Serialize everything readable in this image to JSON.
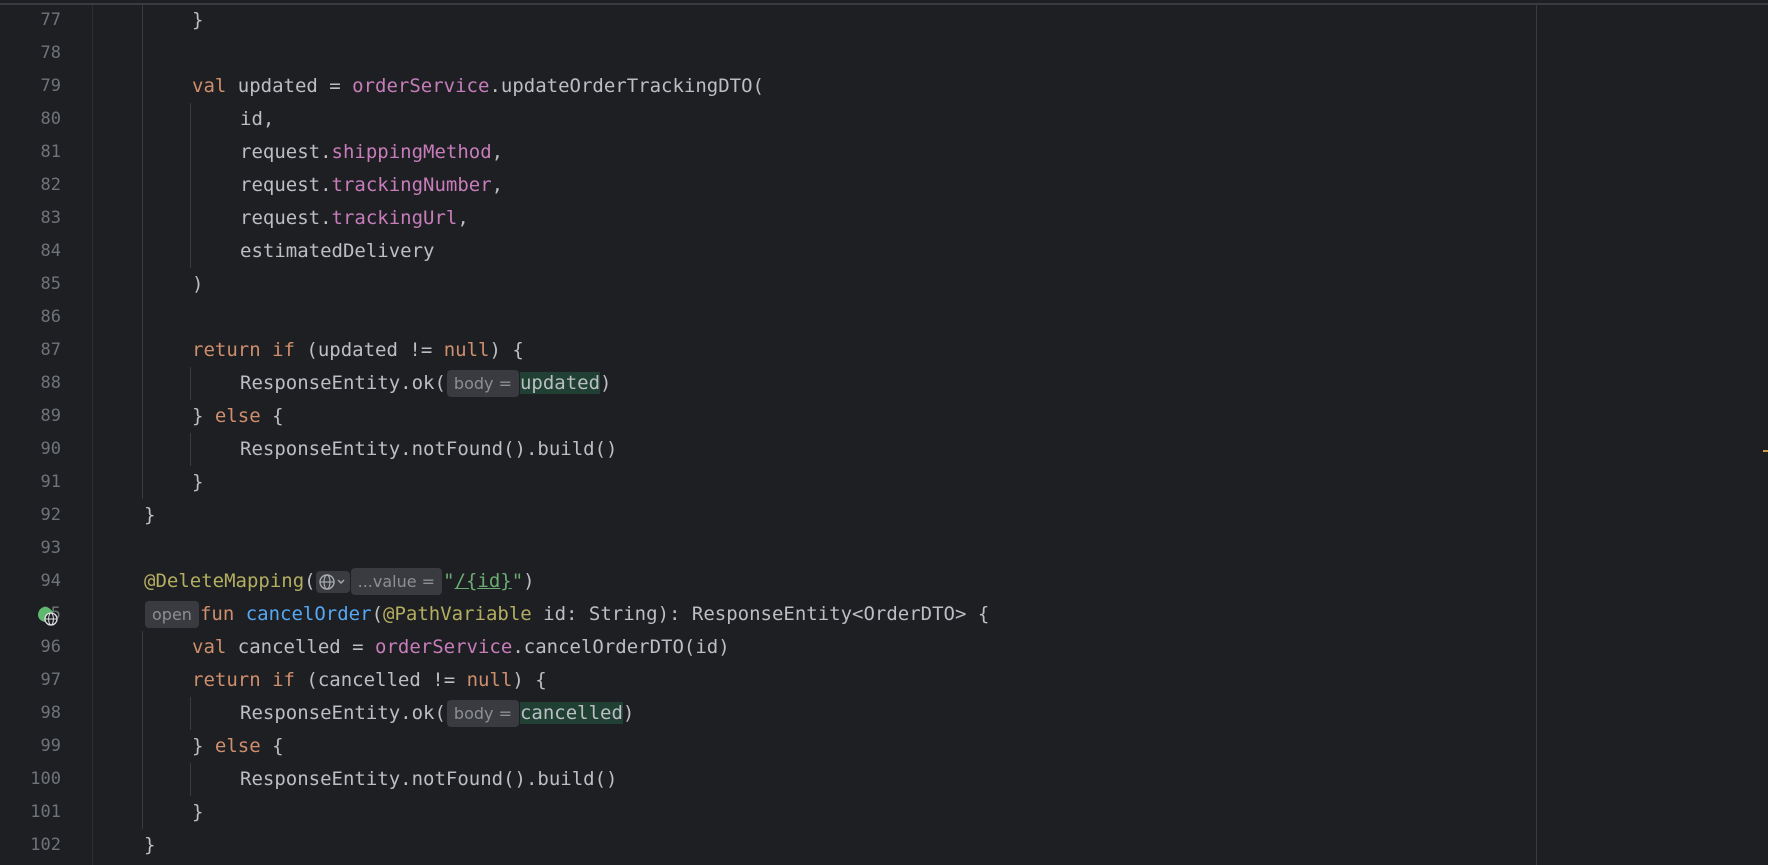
{
  "editor": {
    "lines": [
      {
        "num": "77",
        "indent": 2,
        "tokens": [
          {
            "t": "}",
            "c": "plain"
          }
        ]
      },
      {
        "num": "78",
        "indent": 0,
        "tokens": []
      },
      {
        "num": "79",
        "indent": 2,
        "tokens": [
          {
            "t": "val",
            "c": "kw"
          },
          {
            "t": " updated = ",
            "c": "plain"
          },
          {
            "t": "orderService",
            "c": "prop"
          },
          {
            "t": ".updateOrderTrackingDTO(",
            "c": "plain"
          }
        ]
      },
      {
        "num": "80",
        "indent": 3,
        "tokens": [
          {
            "t": "id,",
            "c": "plain"
          }
        ]
      },
      {
        "num": "81",
        "indent": 3,
        "tokens": [
          {
            "t": "request.",
            "c": "plain"
          },
          {
            "t": "shippingMethod",
            "c": "prop"
          },
          {
            "t": ",",
            "c": "plain"
          }
        ]
      },
      {
        "num": "82",
        "indent": 3,
        "tokens": [
          {
            "t": "request.",
            "c": "plain"
          },
          {
            "t": "trackingNumber",
            "c": "prop"
          },
          {
            "t": ",",
            "c": "plain"
          }
        ]
      },
      {
        "num": "83",
        "indent": 3,
        "tokens": [
          {
            "t": "request.",
            "c": "plain"
          },
          {
            "t": "trackingUrl",
            "c": "prop"
          },
          {
            "t": ",",
            "c": "plain"
          }
        ]
      },
      {
        "num": "84",
        "indent": 3,
        "tokens": [
          {
            "t": "estimatedDelivery",
            "c": "plain"
          }
        ]
      },
      {
        "num": "85",
        "indent": 2,
        "tokens": [
          {
            "t": ")",
            "c": "plain"
          }
        ]
      },
      {
        "num": "86",
        "indent": 0,
        "tokens": []
      },
      {
        "num": "87",
        "indent": 2,
        "tokens": [
          {
            "t": "return",
            "c": "kw"
          },
          {
            "t": " ",
            "c": "plain"
          },
          {
            "t": "if",
            "c": "kw"
          },
          {
            "t": " (updated != ",
            "c": "plain"
          },
          {
            "t": "null",
            "c": "kw"
          },
          {
            "t": ") {",
            "c": "plain"
          }
        ]
      },
      {
        "num": "88",
        "indent": 3,
        "tokens": [
          {
            "t": "ResponseEntity.ok(",
            "c": "plain"
          },
          {
            "t": "body =",
            "c": "hint"
          },
          {
            "t": "updated",
            "c": "hl"
          },
          {
            "t": ")",
            "c": "plain"
          }
        ]
      },
      {
        "num": "89",
        "indent": 2,
        "tokens": [
          {
            "t": "} ",
            "c": "plain"
          },
          {
            "t": "else",
            "c": "kw"
          },
          {
            "t": " {",
            "c": "plain"
          }
        ]
      },
      {
        "num": "90",
        "indent": 3,
        "tokens": [
          {
            "t": "ResponseEntity.notFound().build()",
            "c": "plain"
          }
        ]
      },
      {
        "num": "91",
        "indent": 2,
        "tokens": [
          {
            "t": "}",
            "c": "plain"
          }
        ]
      },
      {
        "num": "92",
        "indent": 1,
        "tokens": [
          {
            "t": "}",
            "c": "plain"
          }
        ]
      },
      {
        "num": "93",
        "indent": 0,
        "tokens": []
      },
      {
        "num": "94",
        "indent": 1,
        "tokens": [
          {
            "t": "@DeleteMapping",
            "c": "ann"
          },
          {
            "t": "(",
            "c": "plain"
          },
          {
            "t": "globe",
            "c": "globe"
          },
          {
            "t": "...value =",
            "c": "hint"
          },
          {
            "t": "\"",
            "c": "str"
          },
          {
            "t": "/{id}",
            "c": "strlink"
          },
          {
            "t": "\"",
            "c": "str"
          },
          {
            "t": ")",
            "c": "plain"
          }
        ]
      },
      {
        "num": "95",
        "indent": 1,
        "tokens": [
          {
            "t": "open",
            "c": "hint"
          },
          {
            "t": "fun",
            "c": "kw"
          },
          {
            "t": " ",
            "c": "plain"
          },
          {
            "t": "cancelOrder",
            "c": "fn"
          },
          {
            "t": "(",
            "c": "plain"
          },
          {
            "t": "@PathVariable",
            "c": "ann"
          },
          {
            "t": " id: String): ResponseEntity<OrderDTO> {",
            "c": "plain"
          }
        ]
      },
      {
        "num": "96",
        "indent": 2,
        "tokens": [
          {
            "t": "val",
            "c": "kw"
          },
          {
            "t": " cancelled = ",
            "c": "plain"
          },
          {
            "t": "orderService",
            "c": "prop"
          },
          {
            "t": ".cancelOrderDTO(id)",
            "c": "plain"
          }
        ]
      },
      {
        "num": "97",
        "indent": 2,
        "tokens": [
          {
            "t": "return",
            "c": "kw"
          },
          {
            "t": " ",
            "c": "plain"
          },
          {
            "t": "if",
            "c": "kw"
          },
          {
            "t": " (cancelled != ",
            "c": "plain"
          },
          {
            "t": "null",
            "c": "kw"
          },
          {
            "t": ") {",
            "c": "plain"
          }
        ]
      },
      {
        "num": "98",
        "indent": 3,
        "tokens": [
          {
            "t": "ResponseEntity.ok(",
            "c": "plain"
          },
          {
            "t": "body =",
            "c": "hint"
          },
          {
            "t": "cancelled",
            "c": "hl"
          },
          {
            "t": ")",
            "c": "plain"
          }
        ]
      },
      {
        "num": "99",
        "indent": 2,
        "tokens": [
          {
            "t": "} ",
            "c": "plain"
          },
          {
            "t": "else",
            "c": "kw"
          },
          {
            "t": " {",
            "c": "plain"
          }
        ]
      },
      {
        "num": "100",
        "indent": 3,
        "tokens": [
          {
            "t": "ResponseEntity.notFound().build()",
            "c": "plain"
          }
        ]
      },
      {
        "num": "101",
        "indent": 2,
        "tokens": [
          {
            "t": "}",
            "c": "plain"
          }
        ]
      },
      {
        "num": "102",
        "indent": 1,
        "tokens": [
          {
            "t": "}",
            "c": "plain"
          }
        ]
      }
    ],
    "gutter_icons": [
      {
        "line": "95",
        "icon": "endpoint-run-icon"
      }
    ]
  },
  "colors": {
    "background": "#1e1f22",
    "keyword": "#cf8e6d",
    "property": "#c77dbb",
    "function": "#56a8f5",
    "annotation": "#b3ae60",
    "string": "#6aab73",
    "text": "#bcbec4",
    "line_number": "#6f737a",
    "usage_highlight": "#1f4033"
  }
}
